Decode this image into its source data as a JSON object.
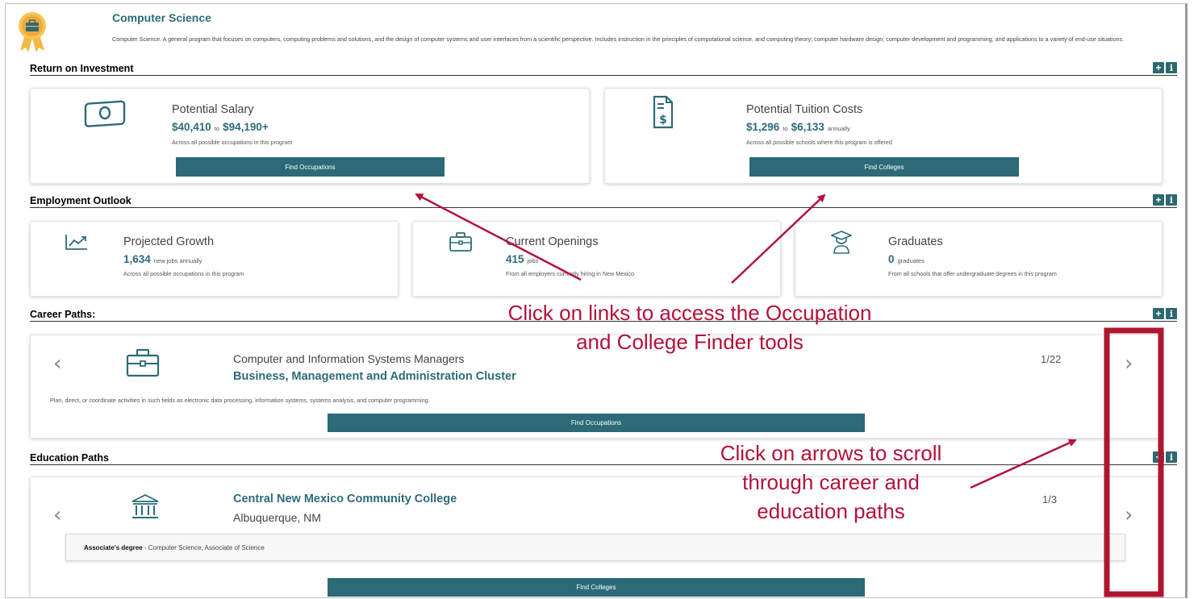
{
  "program": {
    "title": "Computer Science",
    "description": "Computer Science. A general program that focuses on computers, computing problems and solutions, and the design of computer systems and user interfaces from a scientific perspective. Includes instruction in the principles of computational science, and computing theory; computer hardware design; computer development and programming; and applications to a variety of end-use situations."
  },
  "sections": {
    "roi": "Return on Investment",
    "employment": "Employment Outlook",
    "career": "Career Paths:",
    "education": "Education Paths"
  },
  "icons": {
    "plus": "+",
    "info": "i"
  },
  "salary": {
    "title": "Potential Salary",
    "low": "$40,410",
    "to": "to",
    "high": "$94,190+",
    "sub": "Across all possible occupations in this program",
    "button": "Find Occupations"
  },
  "tuition": {
    "title": "Potential Tuition Costs",
    "low": "$1,296",
    "to": "to",
    "high": "$6,133",
    "unit": "annually",
    "sub": "Across all possible schools where this program is offered",
    "button": "Find Colleges"
  },
  "growth": {
    "title": "Projected Growth",
    "value": "1,634",
    "unit": "new jobs annually",
    "sub": "Across all possible occupations in this program"
  },
  "openings": {
    "title": "Current Openings",
    "value": "415",
    "unit": "jobs",
    "sub": "From all employers currently hiring in New Mexico"
  },
  "graduates": {
    "title": "Graduates",
    "value": "0",
    "unit": "graduates",
    "sub": "From all schools that offer undergraduate degrees in this program"
  },
  "career_path": {
    "occupation": "Computer and Information Systems Managers",
    "cluster": "Business, Management and Administration Cluster",
    "count": "1/22",
    "description": "Plan, direct, or coordinate activities in such fields as electronic data processing, information systems, systems analysis, and computer programming.",
    "button": "Find Occupations"
  },
  "education_path": {
    "college": "Central New Mexico Community College",
    "location": "Albuquerque, NM",
    "count": "1/3",
    "degree_type": "Associate's degree",
    "degree_name": " - Computer Science, Associate of Science",
    "button": "Find Colleges"
  },
  "annotations": {
    "links_line1": "Click on links to access the Occupation",
    "links_line2": "and College Finder tools",
    "arrows_line1": "Click on arrows to scroll",
    "arrows_line2": "through career and",
    "arrows_line3": "education paths"
  },
  "colors": {
    "accent": "#2d6b7a",
    "button": "#2c6a78",
    "annotation": "#b3123a"
  }
}
